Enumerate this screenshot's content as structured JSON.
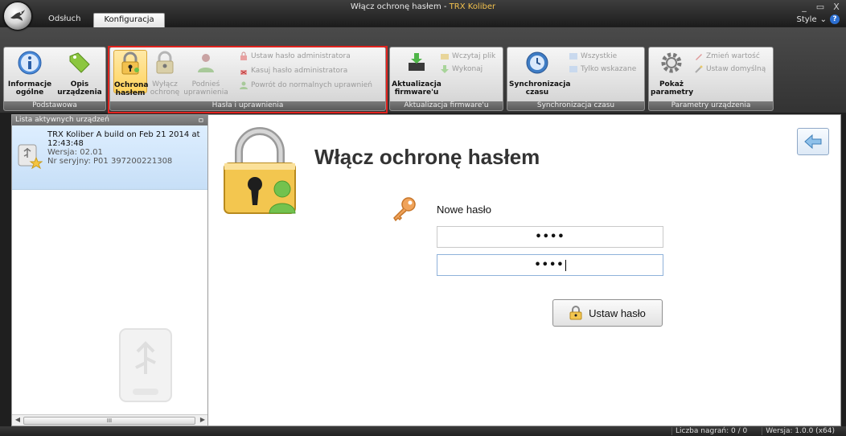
{
  "window": {
    "title_main": "Włącz ochronę hasłem - ",
    "title_app": "TRX Koliber",
    "controls": [
      "_",
      "▭",
      "X"
    ]
  },
  "tabs": [
    {
      "label": "Odsłuch",
      "active": false
    },
    {
      "label": "Konfiguracja",
      "active": true
    }
  ],
  "style_menu": {
    "label": "Style",
    "chevron": "⌄",
    "help": "?"
  },
  "ribbon": {
    "basic": {
      "label": "Podstawowa",
      "info_l1": "Informacje",
      "info_l2": "ogólne",
      "desc_l1": "Opis",
      "desc_l2": "urządzenia"
    },
    "passwords": {
      "label": "Hasła i uprawnienia",
      "protect_l1": "Ochrona",
      "protect_l2": "hasłem",
      "disable_l1": "Wyłącz",
      "disable_l2": "ochronę",
      "raise_l1": "Podnieś",
      "raise_l2": "uprawnienia",
      "set_admin": "Ustaw hasło administratora",
      "clear_admin": "Kasuj hasło administratora",
      "back_normal": "Powrót do normalnych uprawnień"
    },
    "firmware": {
      "label": "Aktualizacja firmware'u",
      "update_l1": "Aktualizacja",
      "update_l2": "firmware'u",
      "load_file": "Wczytaj plik",
      "execute": "Wykonaj"
    },
    "timesync": {
      "label": "Synchronizacja czasu",
      "sync_l1": "Synchronizacja",
      "sync_l2": "czasu",
      "all": "Wszystkie",
      "selected": "Tylko wskazane"
    },
    "params": {
      "label": "Parametry urządzenia",
      "show_l1": "Pokaż",
      "show_l2": "parametry",
      "change": "Zmień wartość",
      "set_default": "Ustaw domyślną"
    }
  },
  "devices_panel": {
    "header": "Lista aktywnych urządzeń",
    "pin": "୧",
    "items": [
      {
        "name": "TRX Koliber A build on Feb 21 2014 at 12:43:48",
        "version": "Wersja: 02.01",
        "serial": "Nr seryjny: P01 397200221308"
      }
    ],
    "scroll_grip": "III"
  },
  "main": {
    "title": "Włącz ochronę hasłem",
    "new_password_label": "Nowe hasło",
    "password1": "••••",
    "password2": "••••",
    "set_button_label": "Ustaw hasło"
  },
  "status": {
    "recordings": "Liczba nagrań: 0 / 0",
    "version": "Wersja: 1.0.0 (x64)"
  },
  "colors": {
    "accent_title": "#f2c14e",
    "highlight": "#e0231e",
    "selection": "#ffd35c"
  }
}
